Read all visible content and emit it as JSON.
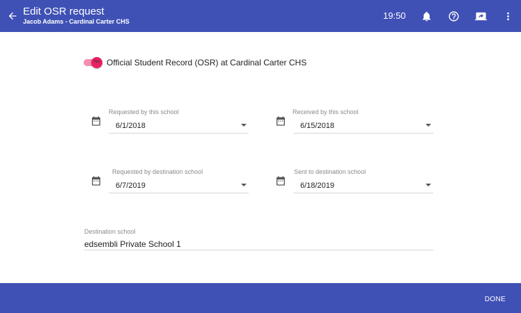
{
  "header": {
    "title": "Edit OSR request",
    "subtitle": "Jacob Adams - Cardinal Carter CHS",
    "time": "19:50"
  },
  "icons": {
    "back": "arrow-back-icon",
    "notifications": "bell-icon",
    "help": "help-circle-icon",
    "screen": "screen-share-icon",
    "more": "more-vert-icon",
    "calendar": "calendar-icon",
    "dropdown": "arrow-drop-down-icon"
  },
  "osr_toggle": {
    "state_text": "Yes",
    "on": true,
    "label": "Official Student Record (OSR) at Cardinal Carter CHS"
  },
  "dates": {
    "requested_by_this_school": {
      "label": "Requested by this school",
      "value": "6/1/2018"
    },
    "received_by_this_school": {
      "label": "Received by this school",
      "value": "6/15/2018"
    },
    "requested_by_destination": {
      "label": "Requested by destination school",
      "value": "6/7/2019"
    },
    "sent_to_destination": {
      "label": "Sent to destination school",
      "value": "6/18/2019"
    }
  },
  "destination": {
    "label": "Destination school",
    "value": "edsembli Private School 1"
  },
  "footer": {
    "done_label": "DONE"
  },
  "colors": {
    "primary": "#3f51b5",
    "toggle_thumb": "#e91e63",
    "toggle_track": "#f48fb1"
  }
}
